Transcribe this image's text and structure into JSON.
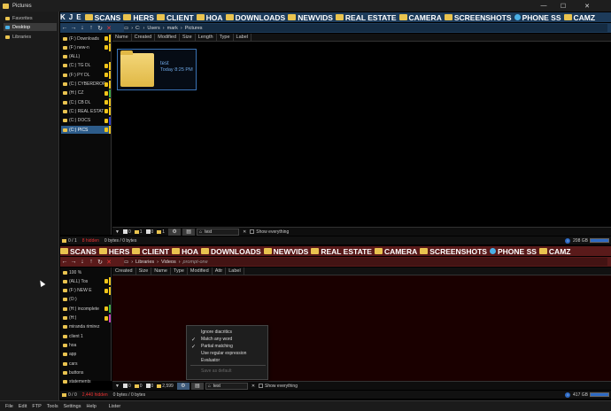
{
  "window": {
    "title": "Pictures",
    "controls": [
      "—",
      "☐",
      "✕"
    ]
  },
  "leftnav": {
    "items": [
      {
        "label": "Favorites",
        "selected": false
      },
      {
        "label": "Desktop",
        "selected": true
      },
      {
        "label": "Libraries",
        "selected": false
      }
    ]
  },
  "favorites_top": {
    "prefix": [
      "K",
      "J",
      "E"
    ],
    "items": [
      "SCANS",
      "HERS",
      "CLIENT",
      "HOA",
      "DOWNLOADS",
      "NEWVIDS",
      "REAL ESTATE",
      "CAMERA",
      "SCREENSHOTS",
      "PHONE SS",
      "CAMZ"
    ]
  },
  "favorites_bottom": {
    "items": [
      "SCANS",
      "HERS",
      "CLIENT",
      "HOA",
      "DOWNLOADS",
      "NEWVIDS",
      "REAL ESTATE",
      "CAMERA",
      "SCREENSHOTS",
      "PHONE SS",
      "CAMZ"
    ]
  },
  "top_pane": {
    "path": [
      "C:",
      "Users",
      "mark",
      "Pictures"
    ],
    "tree": [
      {
        "label": "(F:) Downloads",
        "bar": "#f0c419"
      },
      {
        "label": "(F:) new-n",
        "bar": "#f0c419"
      },
      {
        "label": "(ALL)",
        "bar": ""
      },
      {
        "label": "(C:) TG DL",
        "bar": "#f0c419"
      },
      {
        "label": "(F:) PY DL",
        "bar": "#f0c419"
      },
      {
        "label": "(C:) CYBERDROP",
        "bar": "#f0c419"
      },
      {
        "label": "(H:) CZ",
        "bar": "#3cb043"
      },
      {
        "label": "(C:) CB DL",
        "bar": "#f0c419"
      },
      {
        "label": "(C:) REAL ESTAT",
        "bar": "#f0c419"
      },
      {
        "label": "(C:) DOCS",
        "bar": "#2d3fd6"
      },
      {
        "label": "(C:) PICS",
        "bar": "#f0c419"
      }
    ],
    "columns": [
      "Name",
      "Created",
      "Modified",
      "Size",
      "Length",
      "Type",
      "Label"
    ],
    "files": [
      {
        "name": "test",
        "date": "Today 8:25 PM"
      }
    ],
    "toolbar": {
      "files": "0",
      "folders": "1",
      "f2": "0",
      "f3": "1",
      "filter": "test",
      "show_everything": "Show everything"
    },
    "status": {
      "count": "0 / 1",
      "hidden": "8 hidden",
      "sel_bytes": "0 bytes / 0 bytes",
      "disk": "208 GB"
    }
  },
  "bottom_pane": {
    "path": [
      "Libraries",
      "Videos",
      "prompt-one"
    ],
    "tree": [
      {
        "label": "100 %",
        "bar": ""
      },
      {
        "label": "(ALL) Tos",
        "bar": "#f0c419"
      },
      {
        "label": "(F:) NEW E",
        "bar": "#f0c419"
      },
      {
        "label": "(O:)",
        "bar": ""
      },
      {
        "label": "(H:) incomplete",
        "bar": "#3cb043"
      },
      {
        "label": "(H:)",
        "bar": "#c93fbf"
      },
      {
        "label": "miranda rimirez",
        "bar": ""
      },
      {
        "label": "client 1",
        "bar": ""
      },
      {
        "label": "hoa",
        "bar": ""
      },
      {
        "label": "app",
        "bar": ""
      },
      {
        "label": "cars",
        "bar": ""
      },
      {
        "label": "buttons",
        "bar": ""
      },
      {
        "label": "statements",
        "bar": ""
      }
    ],
    "columns": [
      "Created",
      "Size",
      "Name",
      "Type",
      "Modified",
      "Attr",
      "Label"
    ],
    "toolbar": {
      "files": "0",
      "folders": "0",
      "f2": "0",
      "f3": "2,599",
      "filter": "test",
      "show_everything": "Show everything"
    },
    "status": {
      "count": "0 / 0",
      "hidden": "2,440 hidden",
      "sel_bytes": "0 bytes / 0 bytes",
      "disk": "417 GB"
    }
  },
  "context_menu": {
    "items": [
      {
        "label": "Ignore diacritics",
        "checked": false,
        "disabled": false
      },
      {
        "label": "Match any word",
        "checked": true,
        "disabled": false
      },
      {
        "label": "Partial matching",
        "checked": true,
        "disabled": false
      },
      {
        "label": "Use regular expression",
        "checked": false,
        "disabled": false
      },
      {
        "label": "Evaluator",
        "checked": false,
        "disabled": false
      },
      {
        "label": "Save as default",
        "checked": false,
        "disabled": true
      }
    ]
  },
  "menubar": {
    "items": [
      "File",
      "Edit",
      "FTP",
      "Tools",
      "Settings",
      "Help",
      "Lister"
    ]
  },
  "colors": {
    "top_header": "#1d3b5a",
    "bottom_header": "#5a1a1a",
    "bottom_content": "#1a0000",
    "accent": "#2d6ac4"
  }
}
